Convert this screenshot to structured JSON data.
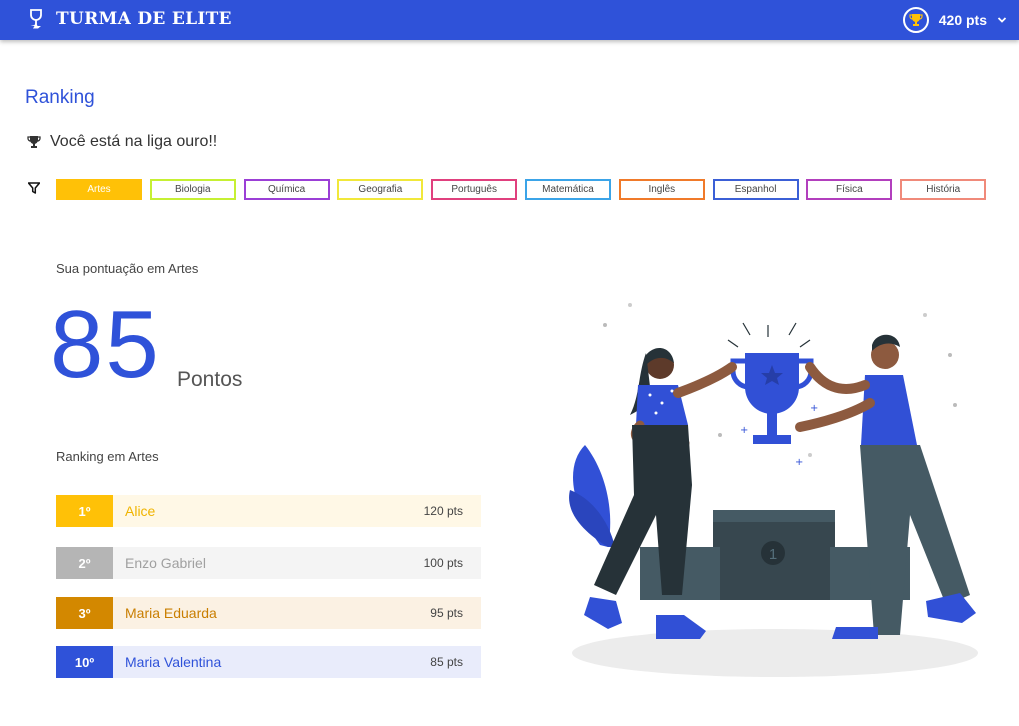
{
  "header": {
    "brand": "TURMA DE ELITE",
    "points": "420 pts"
  },
  "page": {
    "title": "Ranking",
    "league_message": "Você está na liga ouro!!"
  },
  "filters": [
    {
      "label": "Artes",
      "color": "#ffc107",
      "active": true
    },
    {
      "label": "Biologia",
      "color": "#c6f033",
      "active": false
    },
    {
      "label": "Química",
      "color": "#9b3fd6",
      "active": false
    },
    {
      "label": "Geografia",
      "color": "#f1e83a",
      "active": false
    },
    {
      "label": "Português",
      "color": "#e0407e",
      "active": false
    },
    {
      "label": "Matemática",
      "color": "#3ba4e8",
      "active": false
    },
    {
      "label": "Inglês",
      "color": "#f07a2a",
      "active": false
    },
    {
      "label": "Espanhol",
      "color": "#3b5fd6",
      "active": false
    },
    {
      "label": "Física",
      "color": "#b23fbd",
      "active": false
    },
    {
      "label": "História",
      "color": "#f08a7a",
      "active": false
    }
  ],
  "score": {
    "label": "Sua pontuação em Artes",
    "value": "85",
    "unit": "Pontos"
  },
  "ranking": {
    "label": "Ranking em Artes",
    "rows": [
      {
        "position": "1º",
        "name": "Alice",
        "points": "120 pts",
        "pos_color": "#ffc107",
        "row_bg": "#fff8e6",
        "name_color": "#f0b400"
      },
      {
        "position": "2º",
        "name": "Enzo Gabriel",
        "points": "100 pts",
        "pos_color": "#b5b5b5",
        "row_bg": "#f4f4f4",
        "name_color": "#a0a0a0"
      },
      {
        "position": "3º",
        "name": "Maria Eduarda",
        "points": "95 pts",
        "pos_color": "#d38800",
        "row_bg": "#fbf1e3",
        "name_color": "#c97e00"
      },
      {
        "position": "10º",
        "name": "Maria Valentina",
        "points": "85 pts",
        "pos_color": "#2f52d9",
        "row_bg": "#e9ecfb",
        "name_color": "#2f52d9"
      }
    ]
  },
  "colors": {
    "primary": "#2f52d9"
  }
}
